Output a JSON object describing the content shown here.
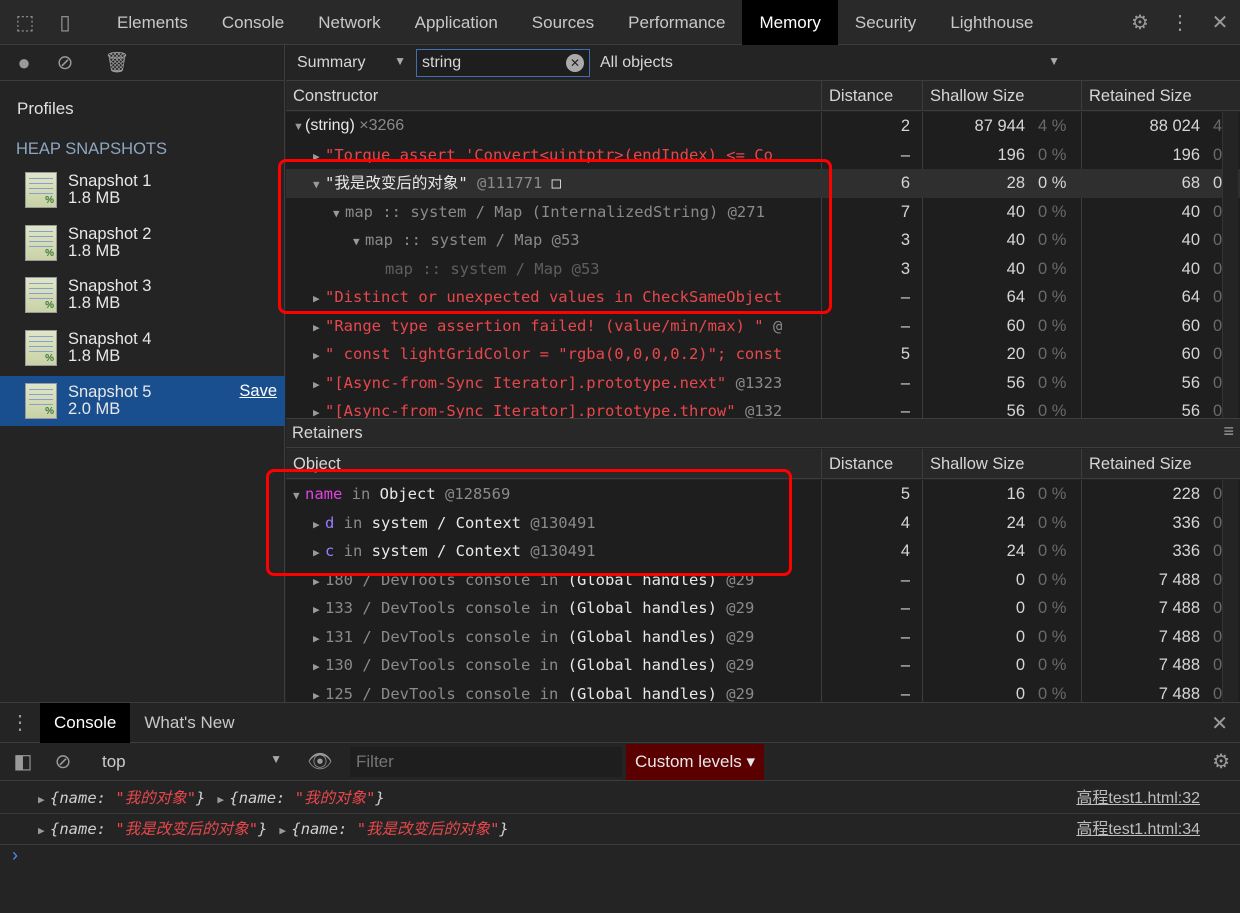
{
  "tabs": [
    "Elements",
    "Console",
    "Network",
    "Application",
    "Sources",
    "Performance",
    "Memory",
    "Security",
    "Lighthouse"
  ],
  "active_tab": "Memory",
  "sidebar": {
    "profiles_label": "Profiles",
    "section_label": "HEAP SNAPSHOTS",
    "save_label": "Save",
    "snapshots": [
      {
        "name": "Snapshot 1",
        "size": "1.8 MB"
      },
      {
        "name": "Snapshot 2",
        "size": "1.8 MB"
      },
      {
        "name": "Snapshot 3",
        "size": "1.8 MB"
      },
      {
        "name": "Snapshot 4",
        "size": "1.8 MB"
      },
      {
        "name": "Snapshot 5",
        "size": "2.0 MB",
        "selected": true
      }
    ]
  },
  "toolbar": {
    "view": "Summary",
    "filter_value": "string",
    "objects": "All objects"
  },
  "columns": {
    "constructor": "Constructor",
    "object": "Object",
    "distance": "Distance",
    "shallow": "Shallow Size",
    "retained": "Retained Size"
  },
  "retainers_label": "Retainers",
  "heap_rows": [
    {
      "indent": 0,
      "arrow": "▼",
      "parts": [
        [
          "white",
          "(string)"
        ],
        [
          "gray",
          "  ×3266"
        ]
      ],
      "dist": "2",
      "sh": "87 944",
      "shp": "4 %",
      "rt": "88 024",
      "rtp": "4 %",
      "sans": true
    },
    {
      "indent": 1,
      "arrow": "▶",
      "parts": [
        [
          "red",
          "\"Torque assert 'Convert<uintptr>(endIndex) <= Co"
        ]
      ],
      "dist": "–",
      "sh": "196",
      "shp": "0 %",
      "rt": "196",
      "rtp": "0 %"
    },
    {
      "indent": 1,
      "arrow": "▼",
      "parts": [
        [
          "white",
          "\"我是改变后的对象\" "
        ],
        [
          "gray",
          "@111771 "
        ],
        [
          "white",
          "□"
        ]
      ],
      "dist": "6",
      "sh": "28",
      "shp": "0 %",
      "rt": "68",
      "rtp": "0 %",
      "sel": true
    },
    {
      "indent": 2,
      "arrow": "▼",
      "parts": [
        [
          "gray",
          "map :: system / Map (InternalizedString) @271"
        ]
      ],
      "dist": "7",
      "sh": "40",
      "shp": "0 %",
      "rt": "40",
      "rtp": "0 %"
    },
    {
      "indent": 3,
      "arrow": "▼",
      "parts": [
        [
          "gray",
          "map :: system / Map @53"
        ]
      ],
      "dist": "3",
      "sh": "40",
      "shp": "0 %",
      "rt": "40",
      "rtp": "0 %"
    },
    {
      "indent": 4,
      "arrow": "",
      "parts": [
        [
          "dim",
          "map :: system / Map @53"
        ]
      ],
      "dist": "3",
      "sh": "40",
      "shp": "0 %",
      "rt": "40",
      "rtp": "0 %"
    },
    {
      "indent": 1,
      "arrow": "▶",
      "parts": [
        [
          "red",
          "\"Distinct or unexpected values in CheckSameObject"
        ]
      ],
      "dist": "–",
      "sh": "64",
      "shp": "0 %",
      "rt": "64",
      "rtp": "0 %"
    },
    {
      "indent": 1,
      "arrow": "▶",
      "parts": [
        [
          "red",
          "\"Range type assertion failed! (value/min/max) \" "
        ],
        [
          "gray",
          "@"
        ]
      ],
      "dist": "–",
      "sh": "60",
      "shp": "0 %",
      "rt": "60",
      "rtp": "0 %"
    },
    {
      "indent": 1,
      "arrow": "▶",
      "parts": [
        [
          "red",
          "\" const lightGridColor = \"rgba(0,0,0,0.2)\"; const"
        ]
      ],
      "dist": "5",
      "sh": "20",
      "shp": "0 %",
      "rt": "60",
      "rtp": "0 %"
    },
    {
      "indent": 1,
      "arrow": "▶",
      "parts": [
        [
          "red",
          "\"[Async-from-Sync Iterator].prototype.next\" "
        ],
        [
          "gray",
          "@1323"
        ]
      ],
      "dist": "–",
      "sh": "56",
      "shp": "0 %",
      "rt": "56",
      "rtp": "0 %"
    },
    {
      "indent": 1,
      "arrow": "▶",
      "parts": [
        [
          "red",
          "\"[Async-from-Sync Iterator].prototype.throw\" "
        ],
        [
          "gray",
          "@132"
        ]
      ],
      "dist": "–",
      "sh": "56",
      "shp": "0 %",
      "rt": "56",
      "rtp": "0 %"
    }
  ],
  "retainer_rows": [
    {
      "indent": 0,
      "arrow": "▼",
      "parts": [
        [
          "mag",
          "name"
        ],
        [
          "gray",
          " in "
        ],
        [
          "white",
          "Object "
        ],
        [
          "gray",
          "@128569"
        ]
      ],
      "dist": "5",
      "sh": "16",
      "shp": "0 %",
      "rt": "228",
      "rtp": "0 %"
    },
    {
      "indent": 1,
      "arrow": "▶",
      "parts": [
        [
          "pur",
          "d"
        ],
        [
          "gray",
          " in "
        ],
        [
          "white",
          "system / Context "
        ],
        [
          "gray",
          "@130491"
        ]
      ],
      "dist": "4",
      "sh": "24",
      "shp": "0 %",
      "rt": "336",
      "rtp": "0 %"
    },
    {
      "indent": 1,
      "arrow": "▶",
      "parts": [
        [
          "pur",
          "c"
        ],
        [
          "gray",
          " in "
        ],
        [
          "white",
          "system / Context "
        ],
        [
          "gray",
          "@130491"
        ]
      ],
      "dist": "4",
      "sh": "24",
      "shp": "0 %",
      "rt": "336",
      "rtp": "0 %"
    },
    {
      "indent": 1,
      "arrow": "▶",
      "parts": [
        [
          "gray",
          "180 / DevTools console in "
        ],
        [
          "white",
          "(Global handles) "
        ],
        [
          "gray",
          "@29"
        ]
      ],
      "dist": "–",
      "sh": "0",
      "shp": "0 %",
      "rt": "7 488",
      "rtp": "0 %"
    },
    {
      "indent": 1,
      "arrow": "▶",
      "parts": [
        [
          "gray",
          "133 / DevTools console in "
        ],
        [
          "white",
          "(Global handles) "
        ],
        [
          "gray",
          "@29"
        ]
      ],
      "dist": "–",
      "sh": "0",
      "shp": "0 %",
      "rt": "7 488",
      "rtp": "0 %"
    },
    {
      "indent": 1,
      "arrow": "▶",
      "parts": [
        [
          "gray",
          "131 / DevTools console in "
        ],
        [
          "white",
          "(Global handles) "
        ],
        [
          "gray",
          "@29"
        ]
      ],
      "dist": "–",
      "sh": "0",
      "shp": "0 %",
      "rt": "7 488",
      "rtp": "0 %"
    },
    {
      "indent": 1,
      "arrow": "▶",
      "parts": [
        [
          "gray",
          "130 / DevTools console in "
        ],
        [
          "white",
          "(Global handles) "
        ],
        [
          "gray",
          "@29"
        ]
      ],
      "dist": "–",
      "sh": "0",
      "shp": "0 %",
      "rt": "7 488",
      "rtp": "0 %"
    },
    {
      "indent": 1,
      "arrow": "▶",
      "parts": [
        [
          "gray",
          "125 / DevTools console in "
        ],
        [
          "white",
          "(Global handles) "
        ],
        [
          "gray",
          "@29"
        ]
      ],
      "dist": "–",
      "sh": "0",
      "shp": "0 %",
      "rt": "7 488",
      "rtp": "0 %"
    }
  ],
  "drawer": {
    "tabs": [
      "Console",
      "What's New"
    ],
    "context": "top",
    "filter_placeholder": "Filter",
    "levels": "Custom levels ▾",
    "messages": [
      {
        "a": "我的对象",
        "b": "我的对象",
        "source": "高程test1.html:32"
      },
      {
        "a": "我是改变后的对象",
        "b": "我是改变后的对象",
        "source": "高程test1.html:34"
      }
    ],
    "prompt": "›"
  }
}
